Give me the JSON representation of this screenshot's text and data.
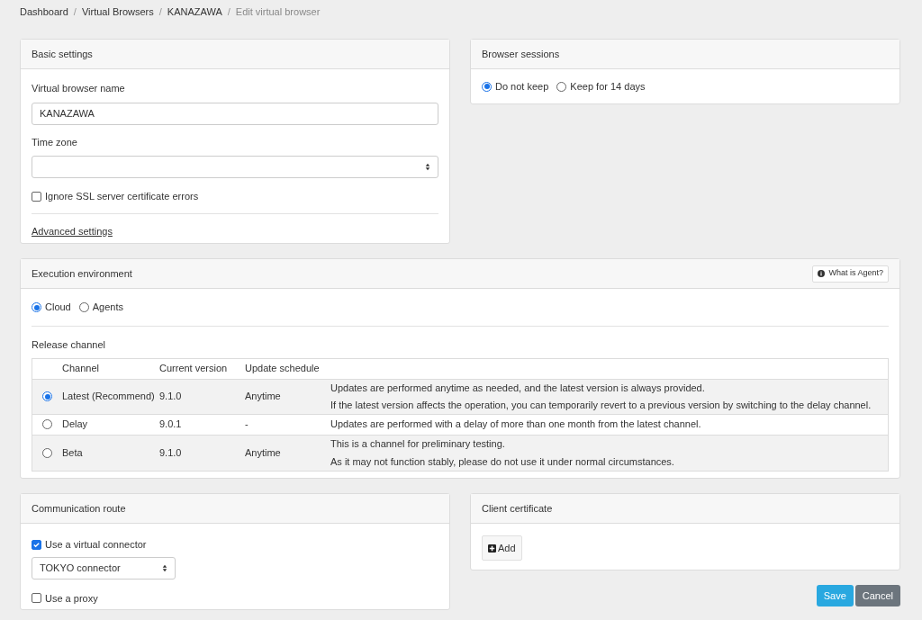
{
  "breadcrumb_separator": "/",
  "breadcrumb": [
    {
      "label": "Dashboard",
      "kind": "link"
    },
    {
      "label": "Virtual Browsers",
      "kind": "link"
    },
    {
      "label": "KANAZAWA",
      "kind": "link"
    },
    {
      "label": "Edit virtual browser",
      "kind": "current"
    }
  ],
  "basic_settings": {
    "title": "Basic settings",
    "name_label": "Virtual browser name",
    "name_value": "KANAZAWA",
    "timezone_label": "Time zone",
    "ignore_ssl": {
      "label": "Ignore SSL server certificate errors",
      "checked": false
    },
    "advanced_link": "Advanced settings"
  },
  "browser_sessions": {
    "title": "Browser sessions",
    "options": [
      {
        "label": "Do not keep",
        "selected": true
      },
      {
        "label": "Keep for 14 days",
        "selected": false
      }
    ]
  },
  "execution_environment": {
    "title": "Execution environment",
    "help_button": "What is Agent?",
    "options": [
      {
        "label": "Cloud",
        "selected": true
      },
      {
        "label": "Agents",
        "selected": false
      }
    ],
    "release_label": "Release channel",
    "columns": [
      "Channel",
      "Current version",
      "Update schedule"
    ],
    "rows": [
      {
        "selected": true,
        "channel": "Latest (Recommend)",
        "version": "9.1.0",
        "schedule": "Anytime",
        "notes": [
          "Updates are performed anytime as needed, and the latest version is always provided.",
          "If the latest version affects the operation, you can temporarily revert to a previous version by switching to the delay channel."
        ]
      },
      {
        "selected": false,
        "channel": "Delay",
        "version": "9.0.1",
        "schedule": "-",
        "notes": [
          "Updates are performed with a delay of more than one month from the latest channel."
        ]
      },
      {
        "selected": false,
        "channel": "Beta",
        "version": "9.1.0",
        "schedule": "Anytime",
        "notes": [
          "This is a channel for preliminary testing.",
          "As it may not function stably, please do not use it under normal circumstances."
        ]
      }
    ]
  },
  "communication_route": {
    "title": "Communication route",
    "virtual_connector": {
      "label": "Use a virtual connector",
      "checked": true
    },
    "connector_value": "TOKYO connector",
    "proxy": {
      "label": "Use a proxy",
      "checked": false
    }
  },
  "client_certificate": {
    "title": "Client certificate",
    "add_button": "Add"
  },
  "actions": {
    "save": "Save",
    "cancel": "Cancel"
  }
}
